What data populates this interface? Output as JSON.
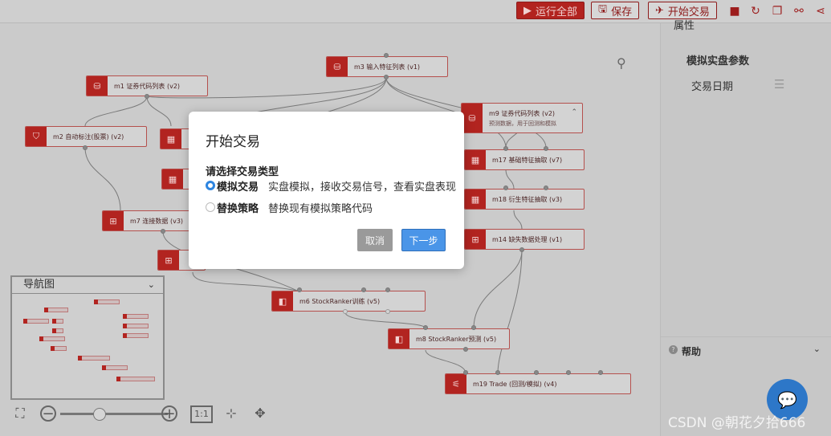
{
  "toolbar": {
    "run_all": "运行全部",
    "save": "保存",
    "start_trading": "开始交易"
  },
  "nodes": {
    "m1": "m1 证券代码列表 (v2)",
    "m2": "m2 自动标注(股票) (v2)",
    "m3": "m3 输入特征列表 (v1)",
    "m9": "m9 证券代码列表 (v2)",
    "m9_sub": "预测数据，用于回测和模拟",
    "m17": "m17 基础特征抽取 (v7)",
    "m18": "m18 衍生特征抽取 (v3)",
    "m14": "m14 缺失数据处理 (v1)",
    "m7": "m7 连接数据 (v3)",
    "m6": "m6 StockRanker训练 (v5)",
    "m8": "m8 StockRanker预测 (v5)",
    "m19": "m19 Trade (回测/模拟) (v4)"
  },
  "navigator": {
    "title": "导航图"
  },
  "zoom": {
    "ratio_label": "1:1"
  },
  "right_panel": {
    "title": "属性",
    "section": "模拟实盘参数",
    "field": "交易日期",
    "help": "帮助"
  },
  "modal": {
    "title": "开始交易",
    "prompt": "请选择交易类型",
    "options": [
      {
        "name": "模拟交易",
        "desc": "实盘模拟，接收交易信号，查看实盘表现",
        "checked": true
      },
      {
        "name": "替换策略",
        "desc": "替换现有模拟策略代码",
        "checked": false
      }
    ],
    "cancel": "取消",
    "next": "下一步"
  },
  "watermark": "CSDN @朝花夕拾666",
  "colors": {
    "accent": "#b2231f",
    "primary_button": "#4a95e8",
    "chat_button": "#2d77c8"
  }
}
